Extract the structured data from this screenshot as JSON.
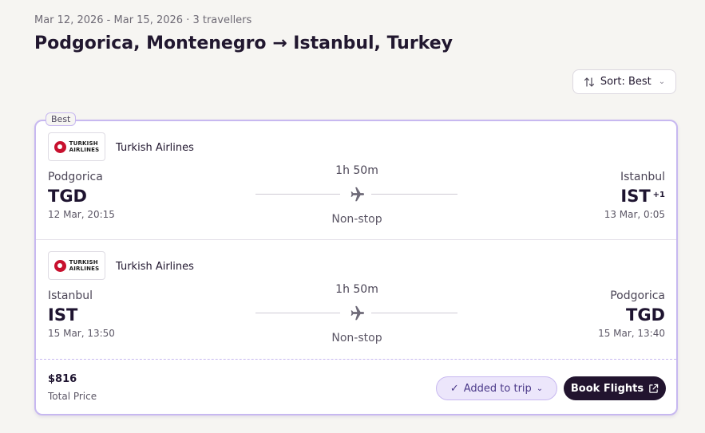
{
  "search": {
    "meta": "Mar 12, 2026 - Mar 15, 2026 · 3 travellers",
    "title": "Podgorica, Montenegro → Istanbul, Turkey"
  },
  "sort": {
    "label": "Sort: Best",
    "icon": "sort-icon"
  },
  "result": {
    "badge": "Best",
    "legs": [
      {
        "airline": "Turkish Airlines",
        "logo_lines": [
          "TURKISH",
          "AIRLINES"
        ],
        "from_city": "Podgorica",
        "from_code": "TGD",
        "depart": "12 Mar, 20:15",
        "duration": "1h 50m",
        "stops": "Non-stop",
        "to_city": "Istanbul",
        "to_code": "IST",
        "day_offset": "+1",
        "arrive": "13 Mar, 0:05"
      },
      {
        "airline": "Turkish Airlines",
        "logo_lines": [
          "TURKISH",
          "AIRLINES"
        ],
        "from_city": "Istanbul",
        "from_code": "IST",
        "depart": "15 Mar, 13:50",
        "duration": "1h 50m",
        "stops": "Non-stop",
        "to_city": "Podgorica",
        "to_code": "TGD",
        "day_offset": "",
        "arrive": "15 Mar, 13:40"
      }
    ],
    "price": "$816",
    "price_label": "Total Price",
    "added_label": "Added to trip",
    "book_label": "Book Flights"
  },
  "colors": {
    "accent": "#c7b8f0",
    "primary_dark": "#22142f",
    "brand_red": "#c8102e"
  }
}
